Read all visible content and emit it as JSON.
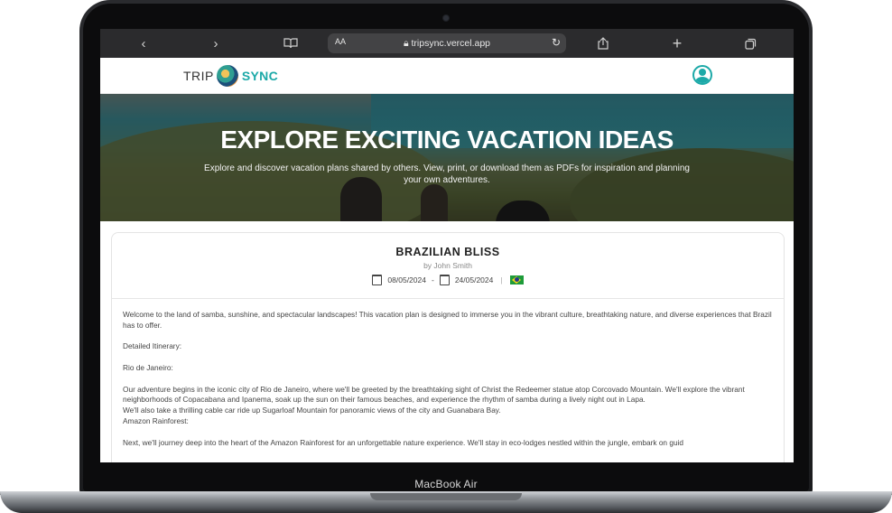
{
  "device": {
    "model_label": "MacBook Air"
  },
  "browser": {
    "text_size_label": "AA",
    "url": "tripsync.vercel.app",
    "icons": [
      "chevron-left-icon",
      "chevron-right-icon",
      "book-icon",
      "lock-icon",
      "reload-icon",
      "share-icon",
      "plus-icon",
      "tabs-icon"
    ]
  },
  "app": {
    "logo_left": "TRIP",
    "logo_right": "SYNC",
    "brand_color": "#1ca9a8"
  },
  "hero": {
    "title": "EXPLORE EXCITING VACATION IDEAS",
    "subtitle": "Explore and discover vacation plans shared by others. View, print, or download them as PDFs for inspiration and planning your own adventures."
  },
  "plan": {
    "title": "BRAZILIAN BLISS",
    "author": "by John Smith",
    "start_date": "08/05/2024",
    "date_separator": "-",
    "end_date": "24/05/2024",
    "country_flag": "brazil-flag-icon",
    "paragraphs": [
      "Welcome to the land of samba, sunshine, and spectacular landscapes! This vacation plan is designed to immerse you in the vibrant culture, breathtaking nature, and diverse experiences that Brazil has to offer.",
      "Detailed Itinerary:",
      "Rio de Janeiro:",
      "Our adventure begins in the iconic city of Rio de Janeiro, where we'll be greeted by the breathtaking sight of Christ the Redeemer statue atop Corcovado Mountain. We'll explore the vibrant neighborhoods of Copacabana and Ipanema, soak up the sun on their famous beaches, and experience the rhythm of samba during a lively night out in Lapa.",
      "We'll also take a thrilling cable car ride up Sugarloaf Mountain for panoramic views of the city and Guanabara Bay.",
      "Amazon Rainforest:",
      "Next, we'll journey deep into the heart of the Amazon Rainforest for an unforgettable nature experience. We'll stay in eco-lodges nestled within the jungle, embark on guid"
    ]
  }
}
